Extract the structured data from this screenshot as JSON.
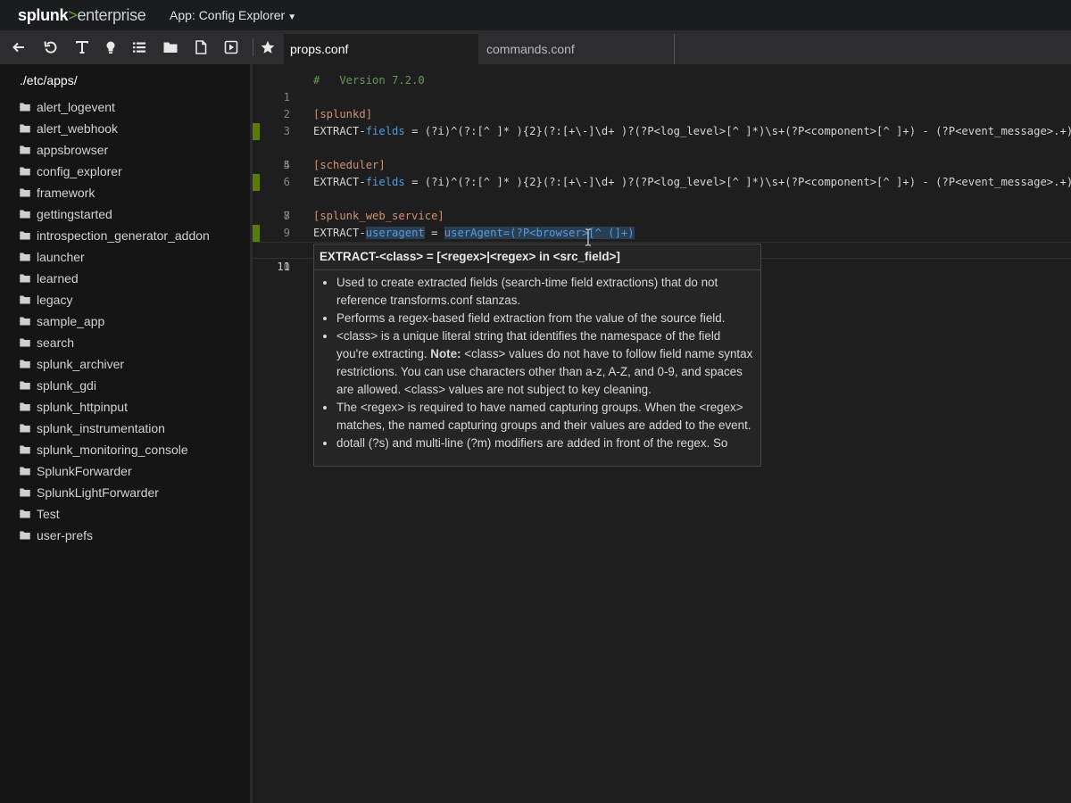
{
  "logo": {
    "part1": "splunk",
    "part2": ">",
    "part3": "enterprise"
  },
  "app_menu": {
    "label": "App: Config Explorer"
  },
  "toolbar": [
    {
      "name": "back-arrow-icon"
    },
    {
      "name": "refresh-icon"
    },
    {
      "name": "text-format-icon"
    },
    {
      "name": "lightbulb-icon"
    },
    {
      "name": "list-icon"
    },
    {
      "name": "folder-icon"
    },
    {
      "name": "file-icon"
    },
    {
      "name": "run-icon"
    },
    {
      "name": "star-icon"
    }
  ],
  "tabs": [
    {
      "label": "props.conf",
      "active": true
    },
    {
      "label": "commands.conf",
      "active": false
    }
  ],
  "sidebar": {
    "path": "./etc/apps/",
    "items": [
      "alert_logevent",
      "alert_webhook",
      "appsbrowser",
      "config_explorer",
      "framework",
      "gettingstarted",
      "introspection_generator_addon",
      "launcher",
      "learned",
      "legacy",
      "sample_app",
      "search",
      "splunk_archiver",
      "splunk_gdi",
      "splunk_httpinput",
      "splunk_instrumentation",
      "splunk_monitoring_console",
      "SplunkForwarder",
      "SplunkLightForwarder",
      "Test",
      "user-prefs"
    ]
  },
  "editor": {
    "line_numbers": [
      "1",
      "2",
      "3",
      "4",
      "5",
      "6",
      "7",
      "8",
      "9",
      "10",
      "11"
    ],
    "lines": {
      "l1": "#   Version 7.2.0",
      "l3": "[splunkd]",
      "l4_key": "EXTRACT-",
      "l4_name": "fields",
      "l4_val": " = (?i)^(?:[^ ]* ){2}(?:[+\\-]\\d+ )?(?P<log_level>[^ ]*)\\s+(?P<component>[^ ]+) - (?P<event_message>.+)",
      "l6": "[scheduler]",
      "l7_key": "EXTRACT-",
      "l7_name": "fields",
      "l7_val": " = (?i)^(?:[^ ]* ){2}(?:[+\\-]\\d+ )?(?P<log_level>[^ ]*)\\s+(?P<component>[^ ]+) - (?P<event_message>.+)",
      "l9": "[splunk_web_service]",
      "l10_key": "EXTRACT-",
      "l10_name": "useragent",
      "l10_eq": " = ",
      "l10_val": "userAgent=(?P<browser>[^ (]+)"
    }
  },
  "tooltip": {
    "title": "EXTRACT-<class> = [<regex>|<regex> in <src_field>]",
    "bullets": [
      "Used to create extracted fields (search-time field extractions) that do not reference transforms.conf stanzas.",
      "Performs a regex-based field extraction from the value of the source field.",
      {
        "pre": "<class> is a unique literal string that identifies the namespace of the field you're extracting. ",
        "bold": "Note:",
        "post": " <class> values do not have to follow field name syntax restrictions. You can use characters other than a-z, A-Z, and 0-9, and spaces are allowed. <class> values are not subject to key cleaning."
      },
      "The <regex> is required to have named capturing groups. When the <regex> matches, the named capturing groups and their values are added to the event.",
      "dotall (?s) and multi-line (?m) modifiers are added in front of the regex. So"
    ]
  },
  "colors": {
    "comment": "#6a9955",
    "section": "#ce9178",
    "keyword": "#569cd6",
    "gutter_mark": "#587c0c",
    "logo_accent": "#65a637"
  }
}
